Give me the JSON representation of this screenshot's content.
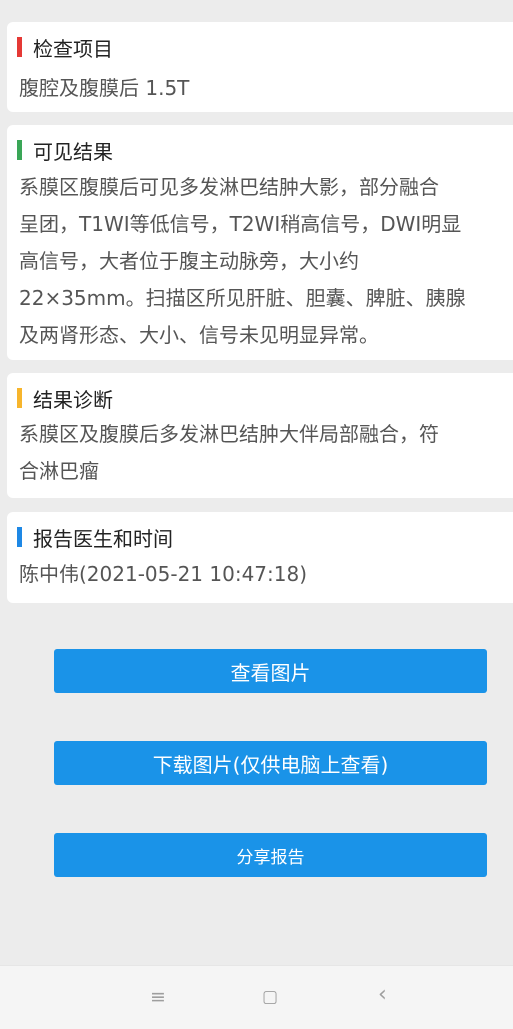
{
  "colors": {
    "primary": "#1a93e8",
    "red": "#e53935",
    "green": "#3aa657",
    "yellow": "#f7b52c",
    "blue": "#1e88e5"
  },
  "sections": [
    {
      "title": "检查项目",
      "content": "腹腔及腹膜后 1.5T"
    },
    {
      "title": "可见结果",
      "content": "系膜区腹膜后可见多发淋巴结肿大影，部分融合\n呈团，T1WI等低信号，T2WI稍高信号，DWI明显\n高信号，大者位于腹主动脉旁，大小约\n22×35mm。扫描区所见肝脏、胆囊、脾脏、胰腺\n及两肾形态、大小、信号未见明显异常。"
    },
    {
      "title": "结果诊断",
      "content": "系膜区及腹膜后多发淋巴结肿大伴局部融合，符\n合淋巴瘤"
    },
    {
      "title": "报告医生和时间",
      "content": "陈中伟(2021-05-21 10:47:18)"
    }
  ],
  "buttons": {
    "view_images": "查看图片",
    "download_images": "下载图片(仅供电脑上查看)",
    "share_report": "分享报告"
  },
  "navbar": {
    "menu_icon": "≡",
    "home_icon": "▢",
    "back_icon": "‹"
  }
}
